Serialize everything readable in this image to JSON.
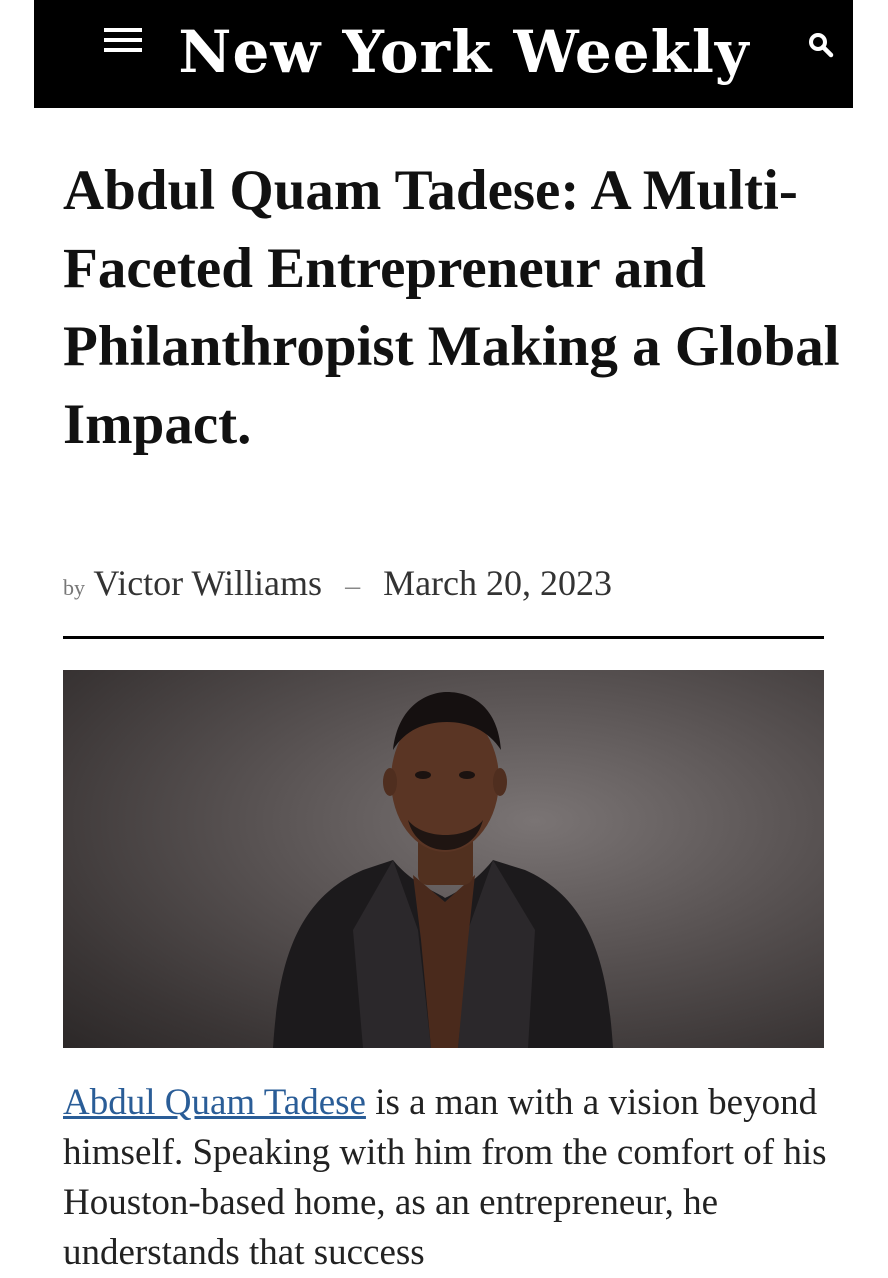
{
  "header": {
    "masthead": "New York Weekly",
    "menu_icon": "hamburger-menu-icon",
    "search_icon": "search-icon",
    "background_color": "#000000",
    "text_color": "#ffffff"
  },
  "article": {
    "headline": "Abdul Quam Tadese: A Multi-Faceted Entrepreneur and Philanthropist Making a Global Impact.",
    "byline_prefix": "by",
    "author": "Victor Williams",
    "separator": "–",
    "date": "March 20, 2023",
    "body": {
      "link_text": "Abdul Quam Tadese",
      "text": " is a man with a vision beyond himself. Speaking with him from the comfort of his Houston-based home, as an entrepreneur, he understands that success"
    }
  },
  "colors": {
    "link": "#2a5d97"
  }
}
